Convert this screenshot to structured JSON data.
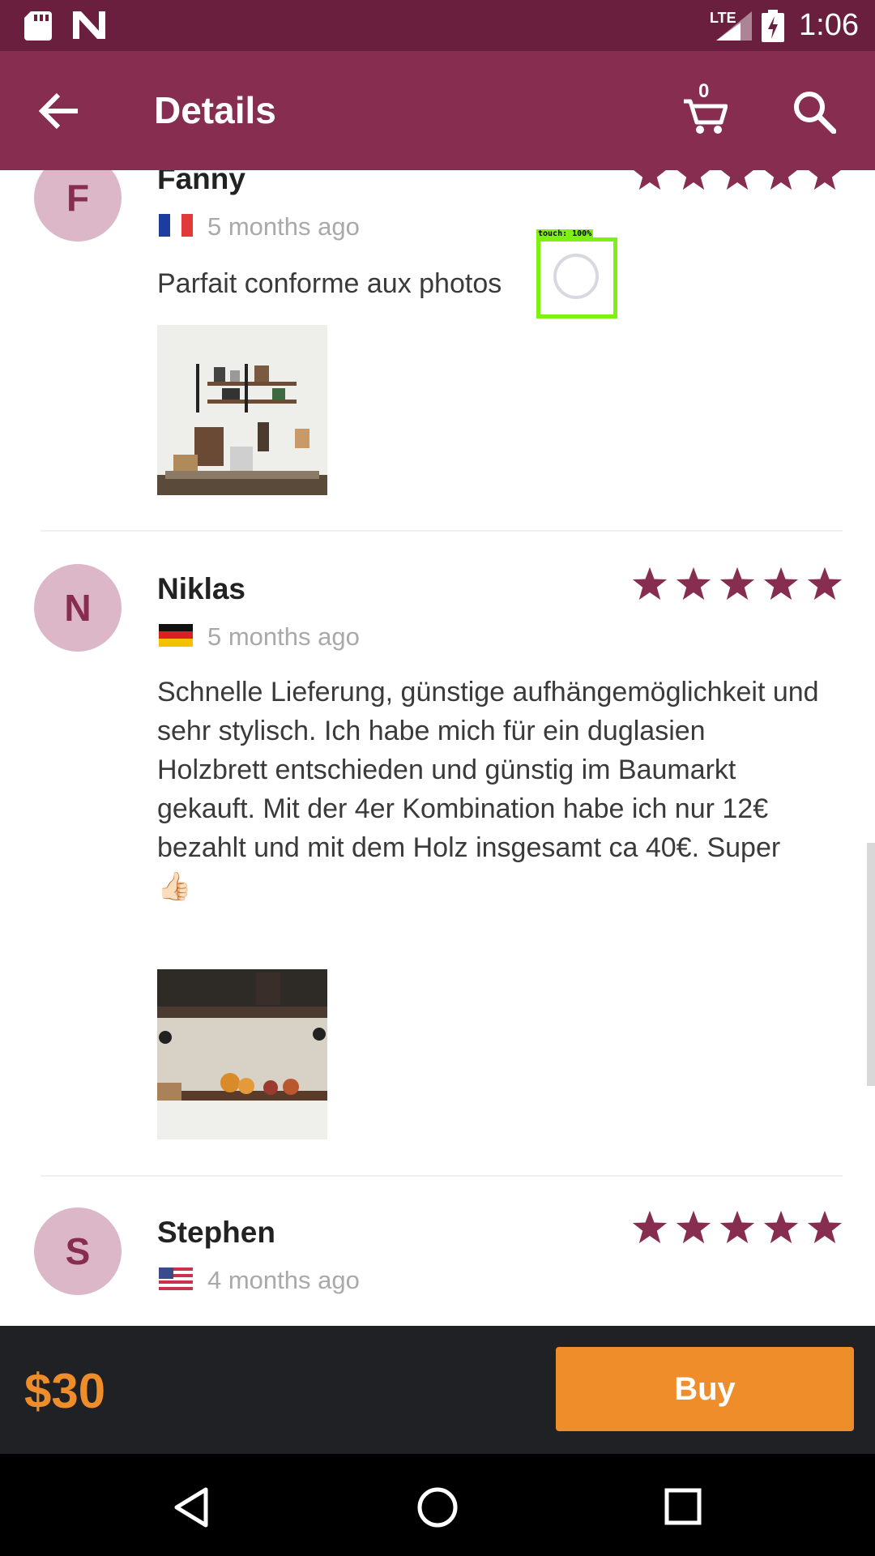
{
  "status_bar": {
    "network": "LTE",
    "time": "1:06"
  },
  "app_bar": {
    "title": "Details",
    "cart_count": "0"
  },
  "reviews": [
    {
      "initial": "F",
      "name": "Fanny",
      "date": "5 months ago",
      "text": "Parfait conforme aux photos",
      "rating": 5,
      "flag_icon": "france-flag-icon",
      "photo_icon": "shelf-photo-icon"
    },
    {
      "initial": "N",
      "name": "Niklas",
      "date": "5 months ago",
      "text": "Schnelle Lieferung, günstige aufhängemöglichkeit und sehr stylisch. Ich habe mich für ein duglasien Holzbrett entschieden und günstig im Baumarkt gekauft. Mit der 4er Kombination habe ich nur 12€ bezahlt und mit dem Holz insgesamt ca 40€. Super 👍🏻",
      "rating": 5,
      "flag_icon": "germany-flag-icon",
      "photo_icon": "shelf-photo-icon"
    },
    {
      "initial": "S",
      "name": "Stephen",
      "date": "4 months ago",
      "rating": 5,
      "flag_icon": "usa-flag-icon"
    }
  ],
  "touch_overlay": {
    "label": "touch: 100%"
  },
  "bottom_bar": {
    "price": "$30",
    "buy_label": "Buy"
  },
  "colors": {
    "primary": "#862d50",
    "status_bar": "#6a1f3e",
    "accent": "#f08d2b",
    "star": "#862d50"
  }
}
